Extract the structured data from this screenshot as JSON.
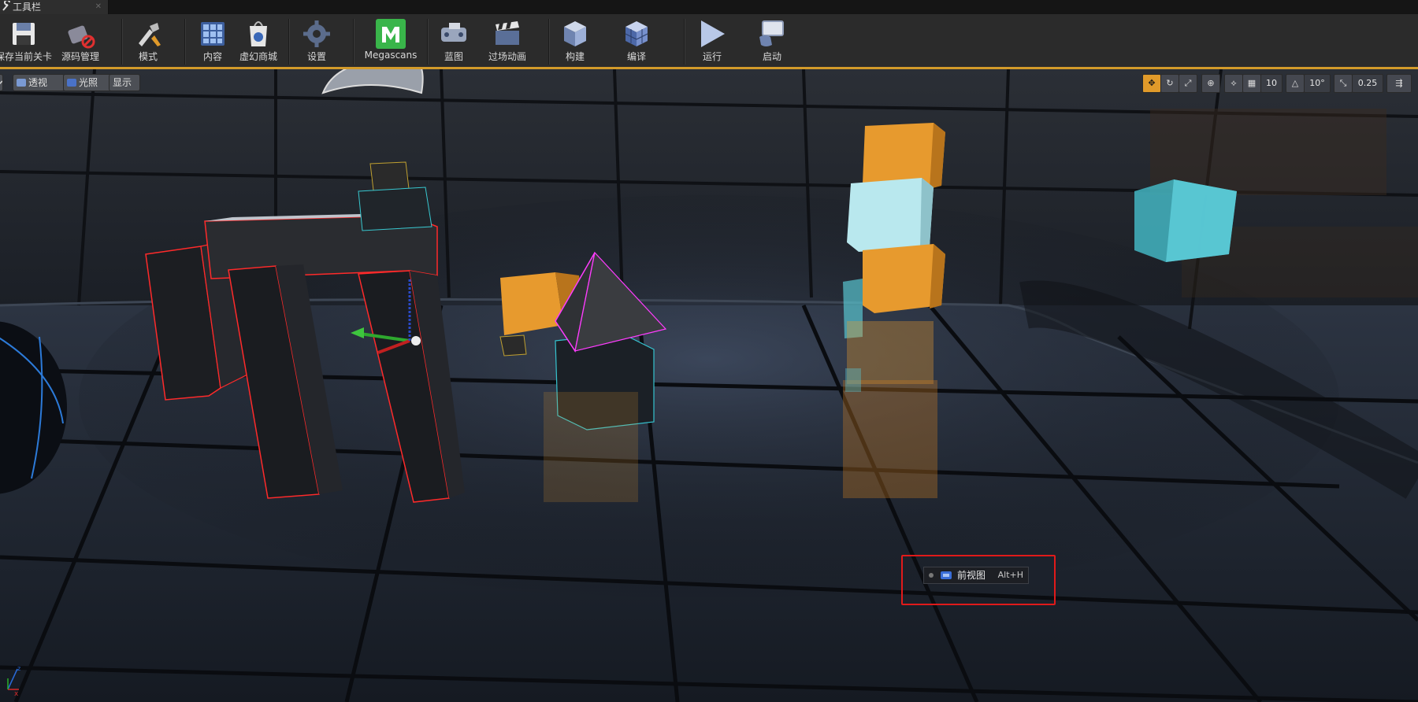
{
  "window": {
    "tab_title": "工具栏"
  },
  "toolbar": {
    "items": [
      {
        "label": "保存当前关卡",
        "icon": "save-icon"
      },
      {
        "label": "源码管理",
        "icon": "source-control-icon"
      },
      {
        "label": "模式",
        "icon": "modes-icon"
      },
      {
        "label": "内容",
        "icon": "content-browser-icon"
      },
      {
        "label": "虚幻商城",
        "icon": "marketplace-icon"
      },
      {
        "label": "设置",
        "icon": "settings-icon"
      },
      {
        "label": "Megascans",
        "icon": "megascans-icon"
      },
      {
        "label": "蓝图",
        "icon": "blueprint-icon"
      },
      {
        "label": "过场动画",
        "icon": "cinematics-icon"
      },
      {
        "label": "构建",
        "icon": "build-icon"
      },
      {
        "label": "编译",
        "icon": "compile-icon"
      },
      {
        "label": "运行",
        "icon": "play-icon"
      },
      {
        "label": "启动",
        "icon": "launch-icon"
      }
    ]
  },
  "viewport": {
    "perspective_label": "透视",
    "lighting_label": "光照",
    "show_label": "显示",
    "grid_snap_value": "10",
    "rotation_snap_value": "10°",
    "scale_snap_value": "0.25"
  },
  "menu_item": {
    "label": "前视图",
    "shortcut": "Alt+H"
  },
  "colors": {
    "toolbar_bg": "#2b2b2b",
    "accent": "#d39a2a",
    "highlight": "#e01a1a",
    "orange_cube": "#e79a2e",
    "cyan_cube": "#b9e8ee",
    "selection_red": "#ff2a2a",
    "selection_magenta": "#ff3cff"
  }
}
